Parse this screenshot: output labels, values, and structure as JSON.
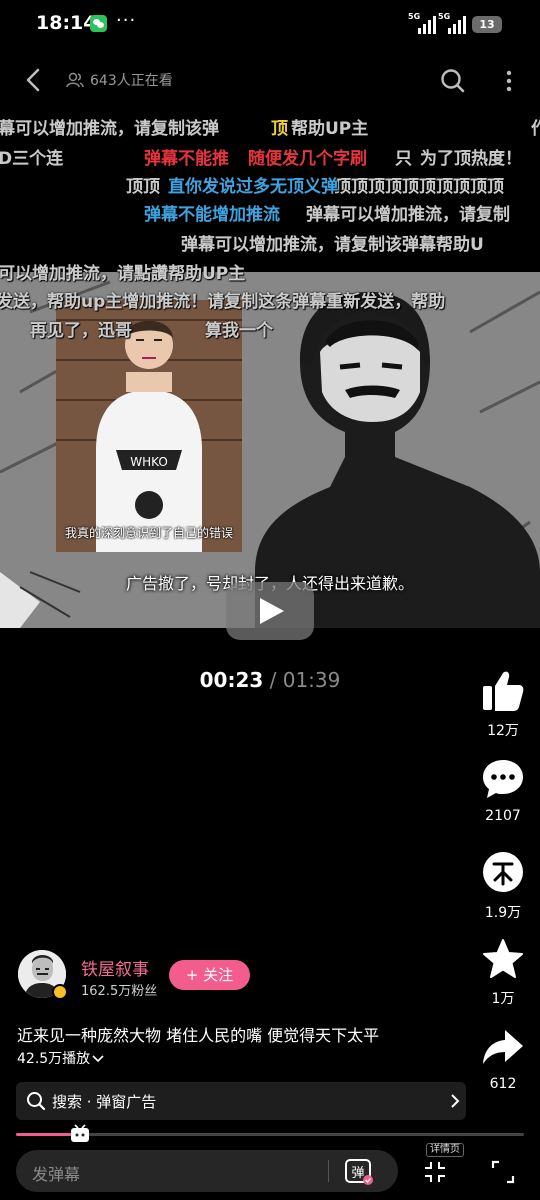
{
  "status": {
    "time": "18:14",
    "more": "···",
    "signal_1": "5G",
    "signal_2": "5G",
    "battery": "13"
  },
  "nav": {
    "viewer_count": "643人正在看"
  },
  "danmaku": [
    "幕可以增加推流，请复制该弹",
    "顶",
    "帮助UP主",
    "作",
    "D三个连",
    "弹幕不能推",
    "随便发几个字刷",
    "只",
    "为了顶热度！",
    "顶顶",
    "顶顶顶顶顶顶顶顶顶顶",
    "直你发说过多无顶义弹",
    "弹幕不能增加推流",
    "弹幕可以增加推流，请复制",
    "弹幕可以增加推流，请复制该弹幕帮助U",
    "可以增加推流，请點讚帮助UP主",
    "发送，帮助up主增加推流！请复制这条弹幕重新发送，帮助",
    "再见了，迅哥",
    "算我一个"
  ],
  "video": {
    "inset_caption": "我真的深刻意识到了自己的错误",
    "caption": "广告撤了，号却封了，人还得出来道歉。",
    "time_current": "00:23",
    "time_separator": " / ",
    "time_total": "01:39",
    "progress": 0.23
  },
  "actions": {
    "like_count": "12万",
    "comment_count": "2107",
    "coin_count": "1.9万",
    "fav_count": "1万",
    "share_count": "612"
  },
  "author": {
    "name": "铁屋叙事",
    "fans": "162.5万粉丝",
    "follow_label": "+ 关注"
  },
  "description": "近来见一种庞然大物 堵住人民的嘴 便觉得天下太平",
  "play_count": "42.5万播放",
  "search_ad": "搜索 · 弹窗广告",
  "bottom": {
    "placeholder": "发弹幕",
    "danmaku_toggle": "弹",
    "detail_label": "详情页"
  },
  "colors": {
    "accent": "#f25d8e",
    "author_name": "#f46b93",
    "background": "#000000"
  }
}
